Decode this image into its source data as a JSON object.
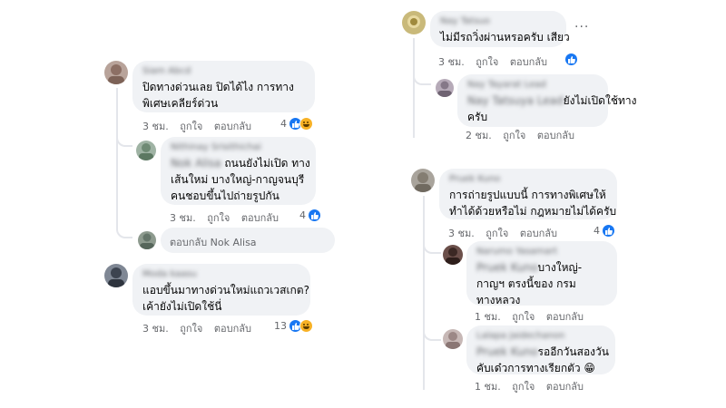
{
  "colors": {
    "like": "#1877f2",
    "haha": "#f7b125",
    "bubble": "#f0f2f5",
    "meta": "#65676b"
  },
  "left": {
    "c1": {
      "name": "Siam Abcd",
      "lines": [
        "ปิดทางด่วนเลย ปิดได้ไง การทาง",
        "พิเศษเคลียร์ด่วน"
      ],
      "time": "3 ชม.",
      "like": "ถูกใจ",
      "reply": "ตอบกลับ",
      "count": "4"
    },
    "c1r1": {
      "name": "Nithinay Srisithichai",
      "tag": "Nok Alisa",
      "lines": [
        "ถนนยังไม่เปิด ทาง",
        "เส้นใหม่ บางใหญ่-กาญจนบุรี",
        "คนชอบขึ้นไปถ่ายรูปกัน"
      ],
      "time": "3 ชม.",
      "like": "ถูกใจ",
      "reply": "ตอบกลับ",
      "count": "4"
    },
    "reply_prompt": "ตอบกลับ Nok Alisa",
    "c2": {
      "name": "Moda kaasu",
      "lines": [
        "แอบขึ้นมาทางด่วนใหม่แถวเวสเกต?",
        "เค้ายังไม่เปิดใช้นี่"
      ],
      "time": "3 ชม.",
      "like": "ถูกใจ",
      "reply": "ตอบกลับ",
      "count": "13"
    }
  },
  "right": {
    "c1": {
      "name": "Nay Tatsuo",
      "lines": [
        "ไม่มีรถวิ่งผ่านหรอครับ เสียว"
      ],
      "time": "3 ชม.",
      "like": "ถูกใจ",
      "reply": "ตอบกลับ"
    },
    "c1r1": {
      "name": "Nay Tayarat Lead",
      "tag": "Nay Tatsuya Lead",
      "lines": [
        "ยังไม่เปิดใช้ทาง",
        "ครับ"
      ],
      "time": "2 ชม.",
      "like": "ถูกใจ",
      "reply": "ตอบกลับ"
    },
    "c2": {
      "name": "Pruek Kuno",
      "lines": [
        "การถ่ายรูปแบบนี้ การทางพิเศษให้",
        "ทำได้ด้วยหรือไม่ กฎหมายไม่ได้ครับ"
      ],
      "time": "3 ชม.",
      "like": "ถูกใจ",
      "reply": "ตอบกลับ",
      "count": "4"
    },
    "c2r1": {
      "name": "Narumo Yasamart",
      "tag": "Pruek Kuno",
      "lines": [
        "บางใหญ่-",
        "กาญฯ ตรงนี้ของ กรม",
        "ทางหลวง"
      ],
      "time": "1 ชม.",
      "like": "ถูกใจ",
      "reply": "ตอบกลับ"
    },
    "c2r2": {
      "name": "Lalapa Jaidechanon",
      "tag": "Pruek Kuno",
      "lines": [
        "รออีกวันสองวัน",
        "คับเด๋วการทางเรียกตัว 😁"
      ],
      "time": "1 ชม.",
      "like": "ถูกใจ",
      "reply": "ตอบกลับ"
    }
  }
}
